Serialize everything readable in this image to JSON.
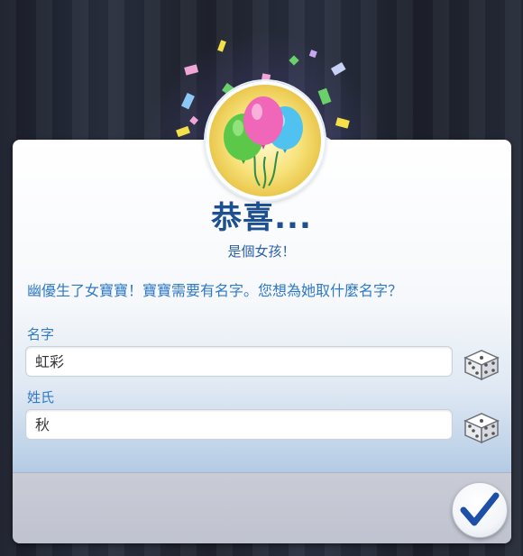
{
  "dialog": {
    "title": "恭喜...",
    "subtitle": "是個女孩！",
    "message": "幽優生了女寶寶！寶寶需要有名字。您想為她取什麼名字？"
  },
  "form": {
    "first_name_label": "名字",
    "first_name_value": "虹彩",
    "last_name_label": "姓氏",
    "last_name_value": "秋"
  },
  "icons": {
    "badge": "balloons-icon",
    "randomize": "dice-icon",
    "confirm": "checkmark-icon"
  },
  "colors": {
    "accent": "#2f79c7",
    "title": "#1d4f91"
  }
}
